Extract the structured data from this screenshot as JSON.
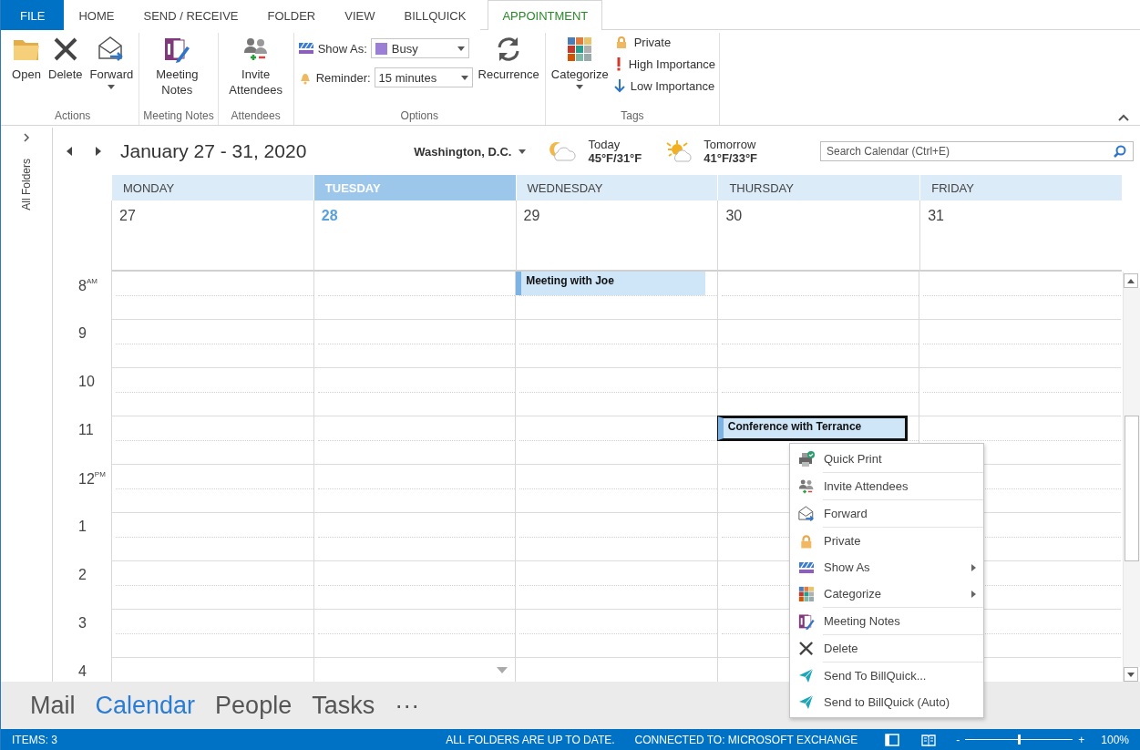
{
  "ribbon_tabs": [
    {
      "label": "FILE",
      "kind": "file",
      "selected": false
    },
    {
      "label": "HOME",
      "kind": "tab",
      "selected": false
    },
    {
      "label": "SEND / RECEIVE",
      "kind": "tab",
      "selected": false
    },
    {
      "label": "FOLDER",
      "kind": "tab",
      "selected": false
    },
    {
      "label": "VIEW",
      "kind": "tab",
      "selected": false
    },
    {
      "label": "BILLQUICK",
      "kind": "tab",
      "selected": false
    },
    {
      "label": "APPOINTMENT",
      "kind": "tab",
      "selected": true
    }
  ],
  "ribbon_groups": [
    {
      "label": "Actions",
      "buttons": [
        {
          "label": "Open",
          "dropdown": false
        },
        {
          "label": "Delete",
          "dropdown": false
        },
        {
          "label": "Forward",
          "dropdown": true
        }
      ]
    },
    {
      "label": "Meeting Notes",
      "buttons": [
        {
          "label": "Meeting Notes",
          "dropdown": false
        }
      ]
    },
    {
      "label": "Attendees",
      "buttons": [
        {
          "label": "Invite Attendees",
          "dropdown": false
        }
      ]
    },
    {
      "label": "Options",
      "fields": [
        {
          "label": "Show As:",
          "value": "Busy"
        },
        {
          "label": "Reminder:",
          "value": "15 minutes"
        }
      ],
      "buttons": [
        {
          "label": "Recurrence",
          "dropdown": false
        }
      ]
    },
    {
      "label": "Tags",
      "buttons": [
        {
          "label": "Categorize",
          "dropdown": true
        }
      ],
      "items": [
        {
          "label": "Private"
        },
        {
          "label": "High Importance"
        },
        {
          "label": "Low Importance"
        }
      ]
    }
  ],
  "sidebar": {
    "label": "All Folders"
  },
  "calendar": {
    "title": "January 27 - 31, 2020",
    "location": "Washington, D.C.",
    "weather": [
      {
        "label": "Today",
        "temps": "45°F/31°F"
      },
      {
        "label": "Tomorrow",
        "temps": "41°F/33°F"
      }
    ],
    "search": {
      "placeholder": "Search Calendar (Ctrl+E)"
    },
    "hours": [
      "8$^{AM}$",
      "9",
      "10",
      "11",
      "12$^{PM}$",
      "1",
      "2",
      "3",
      "4"
    ],
    "days": [
      {
        "name": "MONDAY",
        "date": "27",
        "today": false,
        "more_below": false,
        "slots": [
          {
            "kind": "empty"
          },
          {
            "kind": "empty"
          },
          {
            "kind": "empty"
          },
          {
            "kind": "empty"
          },
          {
            "kind": "empty"
          },
          {
            "kind": "empty"
          },
          {
            "kind": "empty"
          },
          {
            "kind": "empty"
          },
          {
            "kind": "empty"
          }
        ]
      },
      {
        "name": "TUESDAY",
        "date": "28",
        "today": true,
        "more_below": true,
        "slots": [
          {
            "kind": "empty"
          },
          {
            "kind": "empty"
          },
          {
            "kind": "empty"
          },
          {
            "kind": "empty"
          },
          {
            "kind": "empty"
          },
          {
            "kind": "empty"
          },
          {
            "kind": "empty"
          },
          {
            "kind": "empty"
          },
          {
            "kind": "empty"
          }
        ]
      },
      {
        "name": "WEDNESDAY",
        "date": "29",
        "today": false,
        "more_below": false,
        "slots": [
          {
            "kind": "event",
            "title": "Meeting with Joe",
            "selected": false
          },
          {
            "kind": "empty"
          },
          {
            "kind": "empty"
          },
          {
            "kind": "empty"
          },
          {
            "kind": "empty"
          },
          {
            "kind": "empty"
          },
          {
            "kind": "empty"
          },
          {
            "kind": "empty"
          },
          {
            "kind": "empty"
          }
        ]
      },
      {
        "name": "THURSDAY",
        "date": "30",
        "today": false,
        "more_below": false,
        "slots": [
          {
            "kind": "empty"
          },
          {
            "kind": "empty"
          },
          {
            "kind": "empty"
          },
          {
            "kind": "event",
            "title": "Conference with Terrance",
            "selected": true
          },
          {
            "kind": "empty"
          },
          {
            "kind": "empty"
          },
          {
            "kind": "empty"
          },
          {
            "kind": "empty"
          },
          {
            "kind": "empty"
          }
        ]
      },
      {
        "name": "FRIDAY",
        "date": "31",
        "today": false,
        "more_below": false,
        "slots": [
          {
            "kind": "empty"
          },
          {
            "kind": "empty"
          },
          {
            "kind": "empty"
          },
          {
            "kind": "empty"
          },
          {
            "kind": "empty"
          },
          {
            "kind": "empty"
          },
          {
            "kind": "empty"
          },
          {
            "kind": "empty"
          },
          {
            "kind": "empty"
          }
        ]
      }
    ]
  },
  "context_menu": {
    "items": [
      {
        "label": "Quick Print",
        "submenu": false
      },
      {
        "label": "Invite Attendees",
        "submenu": false
      },
      {
        "label": "Forward",
        "submenu": false
      },
      {
        "label": "Private",
        "submenu": false
      },
      {
        "label": "Show As",
        "submenu": true
      },
      {
        "label": "Categorize",
        "submenu": true
      },
      {
        "label": "Meeting Notes",
        "submenu": false
      },
      {
        "label": "Delete",
        "submenu": false
      },
      {
        "label": "Send To BillQuick...",
        "submenu": false
      },
      {
        "label": "Send to BillQuick (Auto)",
        "submenu": false
      }
    ]
  },
  "navigation": [
    {
      "label": "Mail",
      "selected": false
    },
    {
      "label": "Calendar",
      "selected": true
    },
    {
      "label": "People",
      "selected": false
    },
    {
      "label": "Tasks",
      "selected": false
    },
    {
      "label": "···",
      "selected": false
    }
  ],
  "status_bar": {
    "items": "ITEMS: 3",
    "sync": "ALL FOLDERS ARE UP TO DATE.",
    "connection": "CONNECTED TO: MICROSOFT EXCHANGE",
    "zoom": {
      "minus": "-",
      "plus": "+",
      "level": 0.5,
      "reading": "100%"
    }
  }
}
